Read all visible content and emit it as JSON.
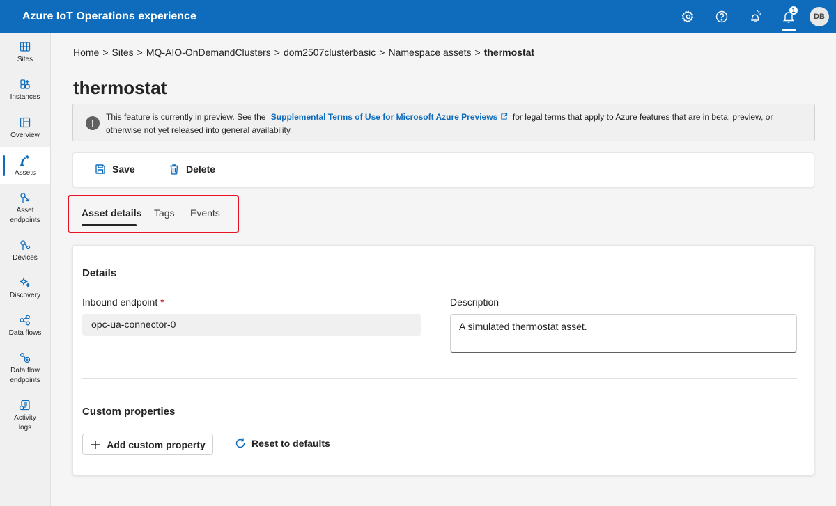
{
  "header": {
    "title": "Azure IoT Operations experience",
    "notification_count": "1",
    "avatar_initials": "DB",
    "icons": [
      "gear-icon",
      "help-icon",
      "feedback-icon",
      "bell-icon"
    ]
  },
  "sidebar": {
    "items": [
      {
        "label": "Sites",
        "icon": "sites-icon"
      },
      {
        "label": "Instances",
        "icon": "instances-icon"
      },
      {
        "label": "Overview",
        "icon": "overview-icon"
      },
      {
        "label": "Assets",
        "icon": "assets-icon",
        "active": true
      },
      {
        "label": "Asset endpoints",
        "icon": "asset-endpoints-icon"
      },
      {
        "label": "Devices",
        "icon": "devices-icon"
      },
      {
        "label": "Discovery",
        "icon": "discovery-icon"
      },
      {
        "label": "Data flows",
        "icon": "data-flows-icon"
      },
      {
        "label": "Data flow endpoints",
        "icon": "data-flow-endpoints-icon"
      },
      {
        "label": "Activity logs",
        "icon": "activity-logs-icon"
      }
    ]
  },
  "breadcrumb": {
    "items": [
      "Home",
      "Sites",
      "MQ-AIO-OnDemandClusters",
      "dom2507clusterbasic",
      "Namespace assets"
    ],
    "current": "thermostat",
    "separator": ">"
  },
  "page": {
    "title": "thermostat"
  },
  "banner": {
    "text_before": "This feature is currently in preview. See the",
    "link_text": "Supplemental Terms of Use for Microsoft Azure Previews",
    "text_after": "for legal terms that apply to Azure features that are in beta, preview, or otherwise not yet released into general availability."
  },
  "toolbar": {
    "save_label": "Save",
    "delete_label": "Delete"
  },
  "tabs": [
    {
      "label": "Asset details",
      "active": true
    },
    {
      "label": "Tags"
    },
    {
      "label": "Events"
    }
  ],
  "details": {
    "section_title": "Details",
    "inbound_endpoint_label": "Inbound endpoint",
    "required_marker": "*",
    "inbound_endpoint_value": "opc-ua-connector-0",
    "description_label": "Description",
    "description_value": "A simulated thermostat asset."
  },
  "custom_properties": {
    "section_title": "Custom properties",
    "add_label": "Add custom property",
    "reset_label": "Reset to defaults"
  },
  "colors": {
    "brand": "#0f6cbd",
    "highlight": "#e81123",
    "required": "#c50f1f"
  }
}
